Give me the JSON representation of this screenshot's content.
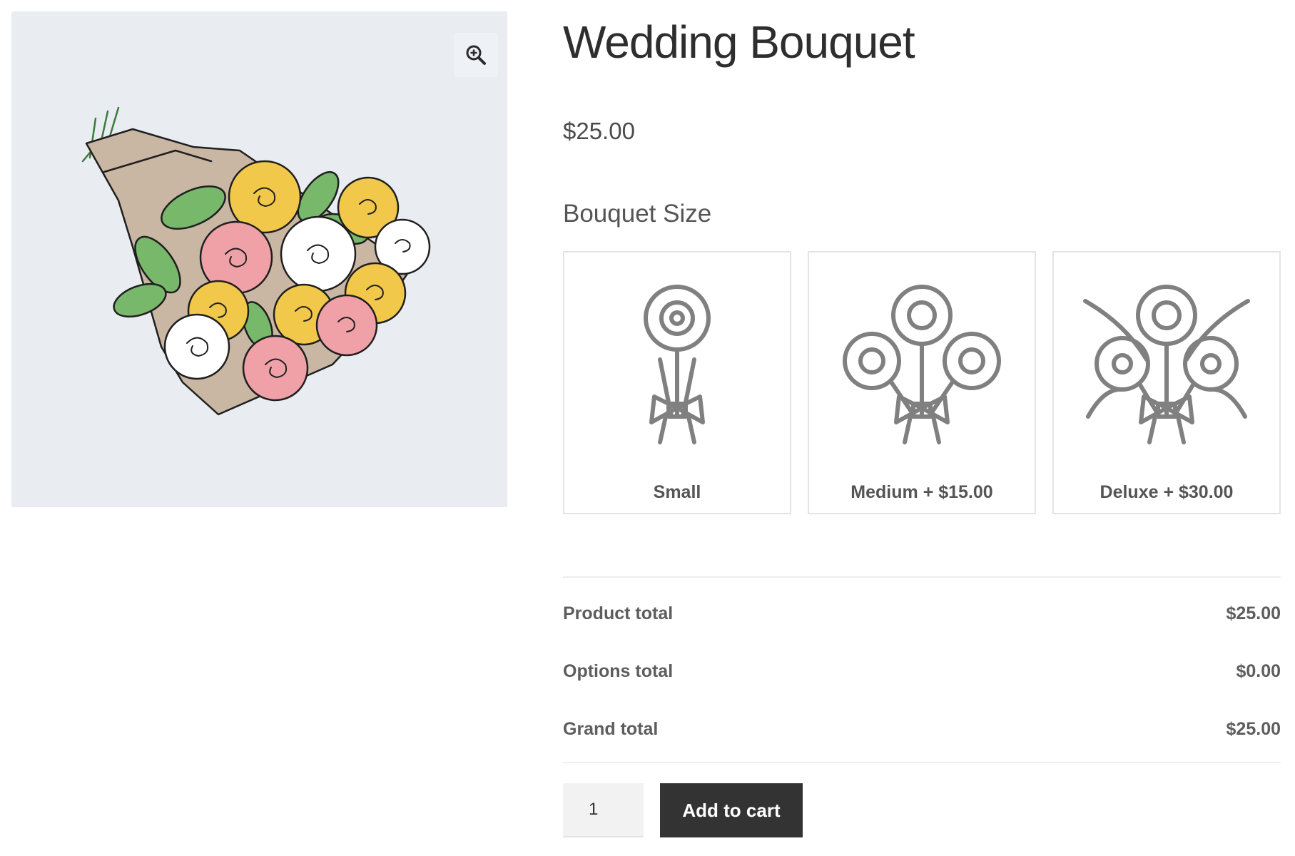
{
  "product": {
    "title": "Wedding Bouquet",
    "price": "$25.00",
    "image_icon": "bouquet-illustration",
    "zoom_icon": "zoom-in-icon"
  },
  "options": {
    "label": "Bouquet Size",
    "items": [
      {
        "label": "Small",
        "icon": "small-bouquet-icon"
      },
      {
        "label": "Medium + $15.00",
        "icon": "medium-bouquet-icon"
      },
      {
        "label": "Deluxe + $30.00",
        "icon": "deluxe-bouquet-icon"
      }
    ]
  },
  "totals": {
    "rows": [
      {
        "label": "Product total",
        "value": "$25.00"
      },
      {
        "label": "Options total",
        "value": "$0.00"
      },
      {
        "label": "Grand total",
        "value": "$25.00"
      }
    ]
  },
  "cart": {
    "quantity": "1",
    "add_label": "Add to cart"
  },
  "colors": {
    "gallery_bg": "#e9edf2",
    "button_bg": "#333333",
    "icon_gray": "#808080",
    "rose_yellow": "#f2c84b",
    "rose_pink": "#f0a1a8",
    "leaf_green": "#77b86b",
    "wrap_tan": "#c9b7a4"
  }
}
